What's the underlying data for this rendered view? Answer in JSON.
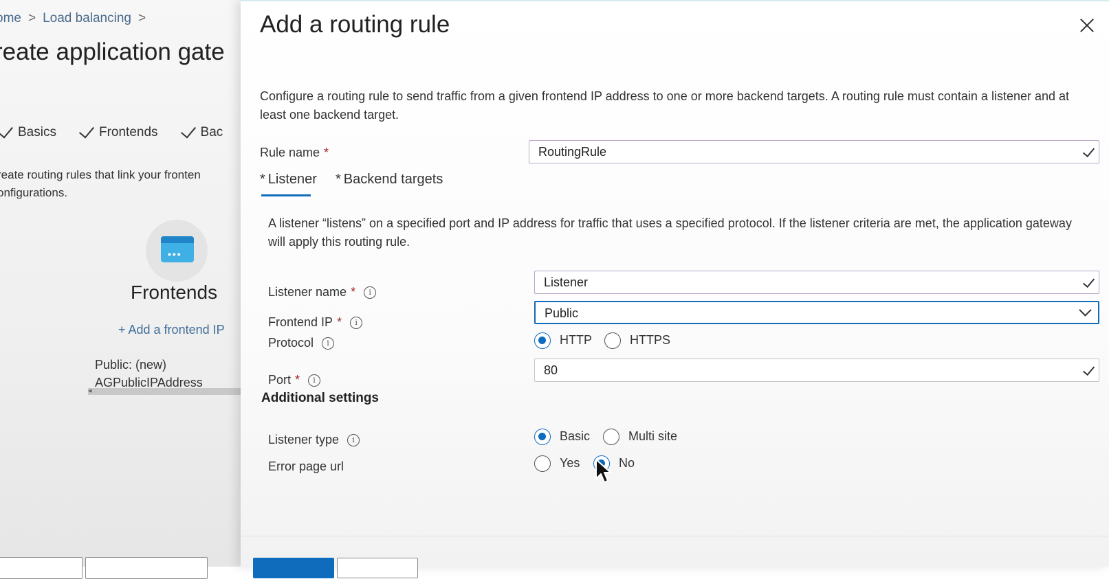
{
  "background": {
    "breadcrumb": {
      "home": "ome",
      "load_balancing": "Load balancing"
    },
    "title": "reate application gate",
    "steps": [
      "Basics",
      "Frontends",
      "Bac"
    ],
    "description": "reate routing rules that link your fronten onfigurations.",
    "frontends_title": "Frontends",
    "add_frontend": "+ Add a frontend IP",
    "frontend_item_line1": "Public: (new)",
    "frontend_item_line2": "AGPublicIPAddress"
  },
  "panel": {
    "title": "Add a routing rule",
    "intro": "Configure a routing rule to send traffic from a given frontend IP address to one or more backend targets. A routing rule must contain a listener and at least one backend target.",
    "rule_name": {
      "label": "Rule name",
      "value": "RoutingRule"
    },
    "tabs": {
      "listener": "Listener",
      "backend_targets": "Backend targets"
    },
    "listener_desc": "A listener “listens” on a specified port and IP address for traffic that uses a specified protocol. If the listener criteria are met, the application gateway will apply this routing rule.",
    "listener_name": {
      "label": "Listener name",
      "value": "Listener"
    },
    "frontend_ip": {
      "label": "Frontend IP",
      "value": "Public"
    },
    "protocol": {
      "label": "Protocol",
      "options": [
        "HTTP",
        "HTTPS"
      ],
      "selected": "HTTP"
    },
    "port": {
      "label": "Port",
      "value": "80"
    },
    "additional_settings": "Additional settings",
    "listener_type": {
      "label": "Listener type",
      "options": [
        "Basic",
        "Multi site"
      ],
      "selected": "Basic"
    },
    "error_page_url": {
      "label": "Error page url",
      "options": [
        "Yes",
        "No"
      ],
      "selected": "No"
    },
    "required_mark": "*",
    "info_glyph": "i"
  },
  "colors": {
    "accent": "#0f6cbd",
    "required": "#a4262c"
  }
}
